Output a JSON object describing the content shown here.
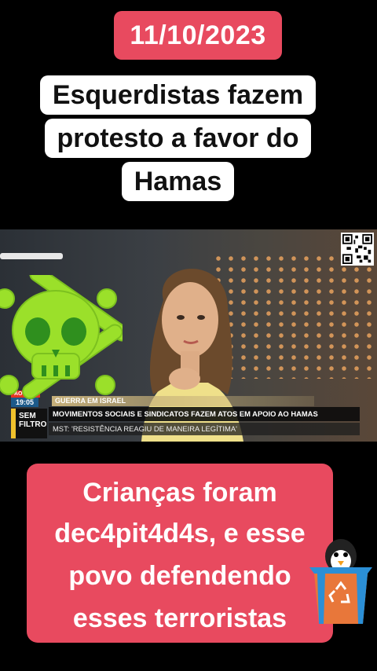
{
  "date": "11/10/2023",
  "headline_top": "Esquerdistas fazem protesto a favor do Hamas",
  "video": {
    "live_tag": "AO VIVO",
    "time": "19:05",
    "section": "GUERRA EM ISRAEL",
    "program": "SEM FILTRO",
    "program_line1": "SEM",
    "program_line2": "FILTRO",
    "main_ticker": "MOVIMENTOS SOCIAIS E SINDICATOS FAZEM ATOS EM APOIO AO HAMAS",
    "sub_ticker": "MST: 'RESISTÊNCIA REAGIU DE MANEIRA LEGÍTIMA'"
  },
  "headline_bottom": {
    "line1": "Crianças foram",
    "line2": "dec4pit4d4s, e esse",
    "line3": "povo defendendo",
    "line4": "esses terroristas"
  },
  "icons": {
    "skull": "skull-crossbones-icon",
    "bin": "recycle-bin-penguin-icon"
  },
  "colors": {
    "accent_red": "#e84a5f",
    "skull_green": "#9be02a"
  }
}
